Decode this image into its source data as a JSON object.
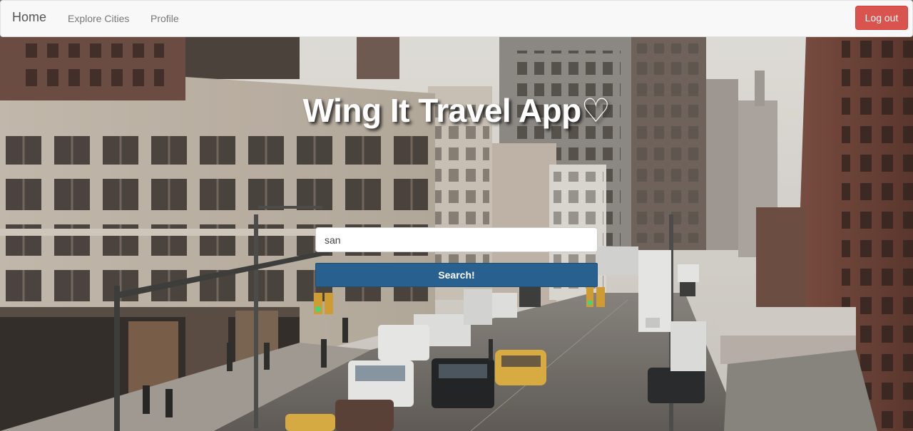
{
  "navbar": {
    "brand": "Home",
    "links": [
      "Explore Cities",
      "Profile"
    ],
    "logout_label": "Log out"
  },
  "hero": {
    "title": "Wing It Travel App♡",
    "search": {
      "value": "san",
      "button_label": "Search!"
    },
    "background_icon": "city-street-photo"
  },
  "colors": {
    "navbar_bg": "#f8f8f8",
    "logout_bg": "#d9534f",
    "search_btn_bg": "#286090",
    "title_color": "#ffffff"
  }
}
